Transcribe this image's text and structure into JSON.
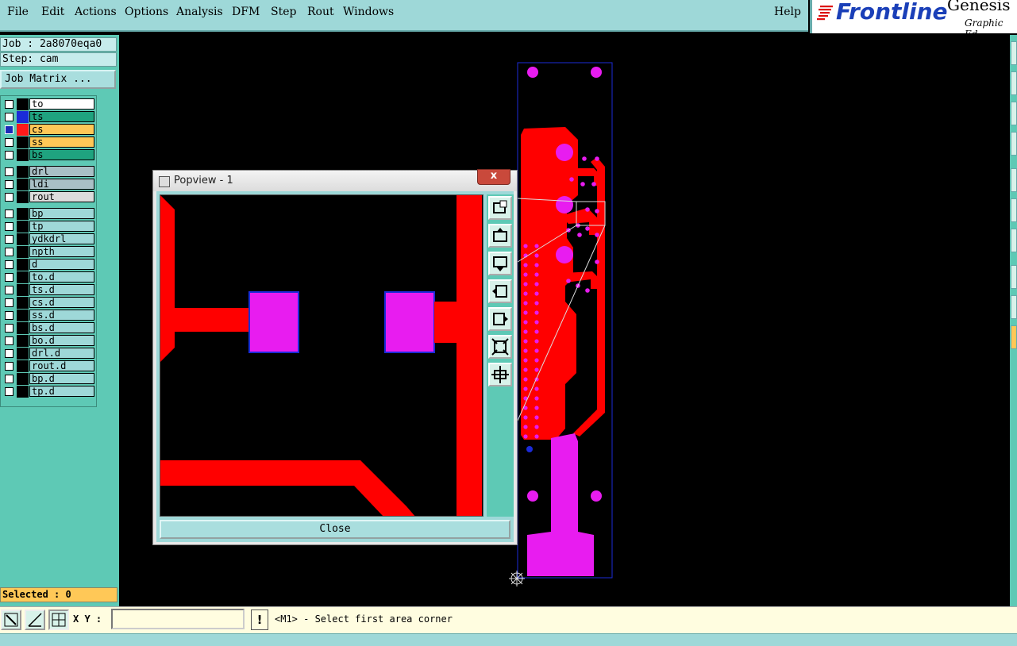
{
  "menu": {
    "items": [
      "File",
      "Edit",
      "Actions",
      "Options",
      "Analysis",
      "DFM",
      "Step",
      "Rout",
      "Windows"
    ],
    "help": "Help"
  },
  "logo": {
    "brand": "Frontline",
    "product": "Genesis",
    "subtitle": "Graphic Ed"
  },
  "job_info": {
    "job": "Job : 2a8070eqa0",
    "step": "Step: cam"
  },
  "job_matrix_label": "Job Matrix ...",
  "layers": [
    {
      "name": "to",
      "bg": "#ffffff",
      "swatch": "#000000",
      "checked": false
    },
    {
      "name": "ts",
      "bg": "#1fa37f",
      "swatch": "#1b2bd8",
      "checked": false
    },
    {
      "name": "cs",
      "bg": "#ffc857",
      "swatch": "#ff1a1a",
      "checked": true
    },
    {
      "name": "ss",
      "bg": "#ffc857",
      "swatch": "#000000",
      "checked": false
    },
    {
      "name": "bs",
      "bg": "#1fa37f",
      "swatch": "#000000",
      "checked": false
    },
    {
      "name": "drl",
      "bg": "#a9c0c6",
      "swatch": "#000000",
      "checked": false
    },
    {
      "name": "ldi",
      "bg": "#a9c0c6",
      "swatch": "#000000",
      "checked": false
    },
    {
      "name": "rout",
      "bg": "#dcdcdc",
      "swatch": "#000000",
      "checked": false
    },
    {
      "name": "bp",
      "bg": "#9ed8d8",
      "swatch": "#000000",
      "checked": false
    },
    {
      "name": "tp",
      "bg": "#9ed8d8",
      "swatch": "#000000",
      "checked": false
    },
    {
      "name": "ydkdrl",
      "bg": "#9ed8d8",
      "swatch": "#000000",
      "checked": false
    },
    {
      "name": "npth",
      "bg": "#9ed8d8",
      "swatch": "#000000",
      "checked": false
    },
    {
      "name": "d",
      "bg": "#9ed8d8",
      "swatch": "#000000",
      "checked": false
    },
    {
      "name": "to.d",
      "bg": "#9ed8d8",
      "swatch": "#000000",
      "checked": false
    },
    {
      "name": "ts.d",
      "bg": "#9ed8d8",
      "swatch": "#000000",
      "checked": false
    },
    {
      "name": "cs.d",
      "bg": "#9ed8d8",
      "swatch": "#000000",
      "checked": false
    },
    {
      "name": "ss.d",
      "bg": "#9ed8d8",
      "swatch": "#000000",
      "checked": false
    },
    {
      "name": "bs.d",
      "bg": "#9ed8d8",
      "swatch": "#000000",
      "checked": false
    },
    {
      "name": "bo.d",
      "bg": "#9ed8d8",
      "swatch": "#000000",
      "checked": false
    },
    {
      "name": "drl.d",
      "bg": "#9ed8d8",
      "swatch": "#000000",
      "checked": false
    },
    {
      "name": "rout.d",
      "bg": "#9ed8d8",
      "swatch": "#000000",
      "checked": false
    },
    {
      "name": "bp.d",
      "bg": "#9ed8d8",
      "swatch": "#000000",
      "checked": false
    },
    {
      "name": "tp.d",
      "bg": "#9ed8d8",
      "swatch": "#000000",
      "checked": false
    }
  ],
  "selected": "Selected : 0",
  "status": {
    "xy_label": "X Y :",
    "xy_value": "",
    "excl": "!",
    "message": "<M1> - Select first area corner"
  },
  "popview": {
    "title": "Popview - 1",
    "close_x": "x",
    "close_button": "Close"
  },
  "colors": {
    "copper": "#ff0000",
    "pad": "#e81cf0",
    "outline": "#1b2bd8",
    "panel": "#5ec9b5"
  }
}
